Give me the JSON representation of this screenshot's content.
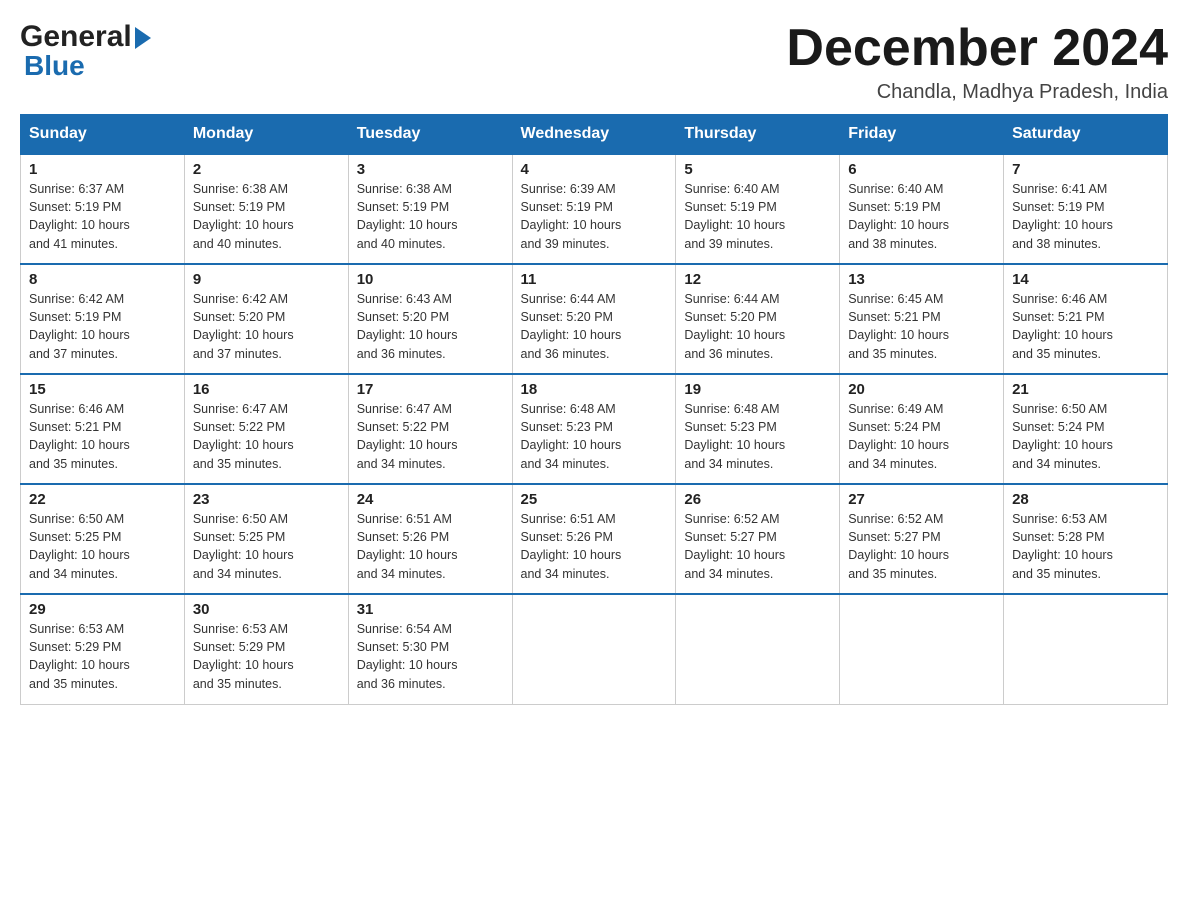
{
  "logo": {
    "general": "General",
    "blue": "Blue"
  },
  "title": "December 2024",
  "location": "Chandla, Madhya Pradesh, India",
  "weekdays": [
    "Sunday",
    "Monday",
    "Tuesday",
    "Wednesday",
    "Thursday",
    "Friday",
    "Saturday"
  ],
  "weeks": [
    [
      {
        "day": "1",
        "sunrise": "6:37 AM",
        "sunset": "5:19 PM",
        "daylight": "10 hours and 41 minutes."
      },
      {
        "day": "2",
        "sunrise": "6:38 AM",
        "sunset": "5:19 PM",
        "daylight": "10 hours and 40 minutes."
      },
      {
        "day": "3",
        "sunrise": "6:38 AM",
        "sunset": "5:19 PM",
        "daylight": "10 hours and 40 minutes."
      },
      {
        "day": "4",
        "sunrise": "6:39 AM",
        "sunset": "5:19 PM",
        "daylight": "10 hours and 39 minutes."
      },
      {
        "day": "5",
        "sunrise": "6:40 AM",
        "sunset": "5:19 PM",
        "daylight": "10 hours and 39 minutes."
      },
      {
        "day": "6",
        "sunrise": "6:40 AM",
        "sunset": "5:19 PM",
        "daylight": "10 hours and 38 minutes."
      },
      {
        "day": "7",
        "sunrise": "6:41 AM",
        "sunset": "5:19 PM",
        "daylight": "10 hours and 38 minutes."
      }
    ],
    [
      {
        "day": "8",
        "sunrise": "6:42 AM",
        "sunset": "5:19 PM",
        "daylight": "10 hours and 37 minutes."
      },
      {
        "day": "9",
        "sunrise": "6:42 AM",
        "sunset": "5:20 PM",
        "daylight": "10 hours and 37 minutes."
      },
      {
        "day": "10",
        "sunrise": "6:43 AM",
        "sunset": "5:20 PM",
        "daylight": "10 hours and 36 minutes."
      },
      {
        "day": "11",
        "sunrise": "6:44 AM",
        "sunset": "5:20 PM",
        "daylight": "10 hours and 36 minutes."
      },
      {
        "day": "12",
        "sunrise": "6:44 AM",
        "sunset": "5:20 PM",
        "daylight": "10 hours and 36 minutes."
      },
      {
        "day": "13",
        "sunrise": "6:45 AM",
        "sunset": "5:21 PM",
        "daylight": "10 hours and 35 minutes."
      },
      {
        "day": "14",
        "sunrise": "6:46 AM",
        "sunset": "5:21 PM",
        "daylight": "10 hours and 35 minutes."
      }
    ],
    [
      {
        "day": "15",
        "sunrise": "6:46 AM",
        "sunset": "5:21 PM",
        "daylight": "10 hours and 35 minutes."
      },
      {
        "day": "16",
        "sunrise": "6:47 AM",
        "sunset": "5:22 PM",
        "daylight": "10 hours and 35 minutes."
      },
      {
        "day": "17",
        "sunrise": "6:47 AM",
        "sunset": "5:22 PM",
        "daylight": "10 hours and 34 minutes."
      },
      {
        "day": "18",
        "sunrise": "6:48 AM",
        "sunset": "5:23 PM",
        "daylight": "10 hours and 34 minutes."
      },
      {
        "day": "19",
        "sunrise": "6:48 AM",
        "sunset": "5:23 PM",
        "daylight": "10 hours and 34 minutes."
      },
      {
        "day": "20",
        "sunrise": "6:49 AM",
        "sunset": "5:24 PM",
        "daylight": "10 hours and 34 minutes."
      },
      {
        "day": "21",
        "sunrise": "6:50 AM",
        "sunset": "5:24 PM",
        "daylight": "10 hours and 34 minutes."
      }
    ],
    [
      {
        "day": "22",
        "sunrise": "6:50 AM",
        "sunset": "5:25 PM",
        "daylight": "10 hours and 34 minutes."
      },
      {
        "day": "23",
        "sunrise": "6:50 AM",
        "sunset": "5:25 PM",
        "daylight": "10 hours and 34 minutes."
      },
      {
        "day": "24",
        "sunrise": "6:51 AM",
        "sunset": "5:26 PM",
        "daylight": "10 hours and 34 minutes."
      },
      {
        "day": "25",
        "sunrise": "6:51 AM",
        "sunset": "5:26 PM",
        "daylight": "10 hours and 34 minutes."
      },
      {
        "day": "26",
        "sunrise": "6:52 AM",
        "sunset": "5:27 PM",
        "daylight": "10 hours and 34 minutes."
      },
      {
        "day": "27",
        "sunrise": "6:52 AM",
        "sunset": "5:27 PM",
        "daylight": "10 hours and 35 minutes."
      },
      {
        "day": "28",
        "sunrise": "6:53 AM",
        "sunset": "5:28 PM",
        "daylight": "10 hours and 35 minutes."
      }
    ],
    [
      {
        "day": "29",
        "sunrise": "6:53 AM",
        "sunset": "5:29 PM",
        "daylight": "10 hours and 35 minutes."
      },
      {
        "day": "30",
        "sunrise": "6:53 AM",
        "sunset": "5:29 PM",
        "daylight": "10 hours and 35 minutes."
      },
      {
        "day": "31",
        "sunrise": "6:54 AM",
        "sunset": "5:30 PM",
        "daylight": "10 hours and 36 minutes."
      },
      null,
      null,
      null,
      null
    ]
  ],
  "labels": {
    "sunrise": "Sunrise:",
    "sunset": "Sunset:",
    "daylight": "Daylight:"
  }
}
